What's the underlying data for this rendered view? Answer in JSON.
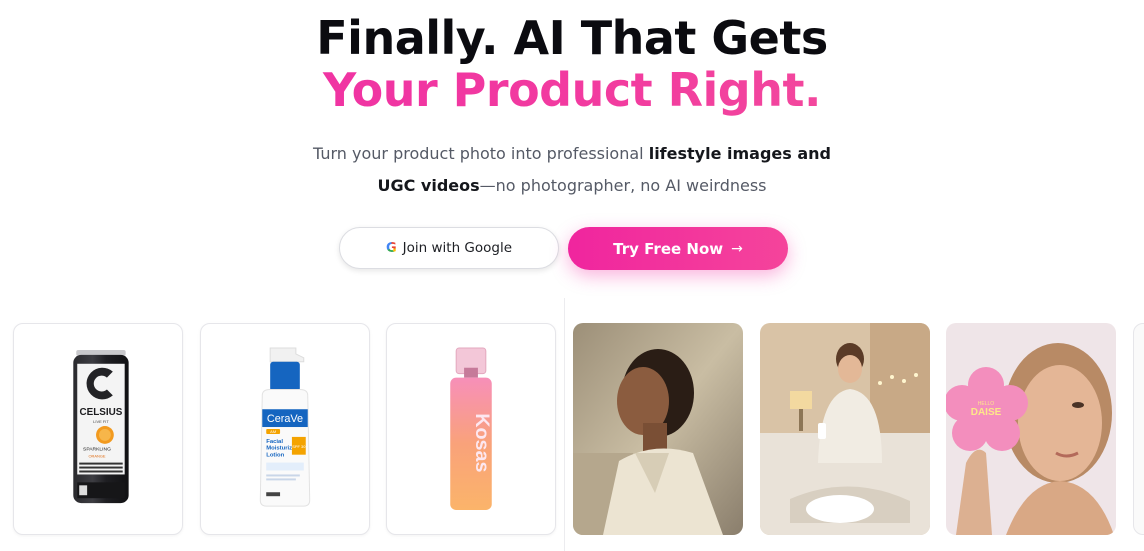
{
  "hero": {
    "title_line1": "Finally. AI That Gets",
    "title_line2": "Your Product Right.",
    "subtitle_part1": "Turn your product photo into professional ",
    "subtitle_bold": "lifestyle images and UGC videos",
    "subtitle_part2": "—no photographer, no AI weirdness"
  },
  "buttons": {
    "google_label": "Join with Google",
    "try_label": "Try Free Now",
    "google_icon": "google-g-icon",
    "try_icon": "arrow-right-icon"
  },
  "colors": {
    "accent": "#F0259E",
    "title": "#0B0B10",
    "text": "#555A66"
  },
  "gallery": {
    "products": [
      {
        "id": "celsius",
        "brand": "CELSIUS",
        "sub": "SPARKLING",
        "brand_small": "LIVE FIT",
        "flavor": "ORANGE"
      },
      {
        "id": "cerave",
        "brand": "CeraVe",
        "line1": "Facial",
        "line2": "Moisturizing",
        "line3": "Lotion",
        "tag": "AM",
        "spf": "SPF 30"
      },
      {
        "id": "kosas",
        "brand": "Kosas"
      }
    ],
    "lifestyle": [
      {
        "id": "woman-portrait"
      },
      {
        "id": "woman-bedroom"
      },
      {
        "id": "woman-daise",
        "brand_small": "HELLO",
        "brand": "DAISE"
      }
    ]
  }
}
